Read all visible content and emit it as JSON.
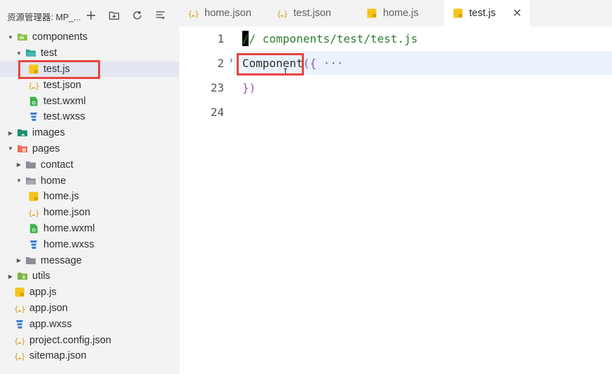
{
  "explorer": {
    "title": "资源管理器: MP_...",
    "actions": [
      "new-file-icon",
      "new-folder-icon",
      "refresh-icon",
      "collapse-all-icon"
    ]
  },
  "tree": [
    {
      "label": "components",
      "type": "folder",
      "icon": "folder-components",
      "depth": 0,
      "expanded": true
    },
    {
      "label": "test",
      "type": "folder",
      "icon": "folder-open",
      "depth": 1,
      "expanded": true
    },
    {
      "label": "test.js",
      "type": "js",
      "depth": 2,
      "selected": true
    },
    {
      "label": "test.json",
      "type": "json",
      "depth": 2
    },
    {
      "label": "test.wxml",
      "type": "wxml",
      "depth": 2
    },
    {
      "label": "test.wxss",
      "type": "wxss",
      "depth": 2
    },
    {
      "label": "images",
      "type": "folder",
      "icon": "folder-images",
      "depth": 0,
      "expanded": false
    },
    {
      "label": "pages",
      "type": "folder",
      "icon": "folder-pages",
      "depth": 0,
      "expanded": true
    },
    {
      "label": "contact",
      "type": "folder",
      "icon": "folder-gray",
      "depth": 1,
      "expanded": false
    },
    {
      "label": "home",
      "type": "folder",
      "icon": "folder-gray-open",
      "depth": 1,
      "expanded": true
    },
    {
      "label": "home.js",
      "type": "js",
      "depth": 2
    },
    {
      "label": "home.json",
      "type": "json",
      "depth": 2
    },
    {
      "label": "home.wxml",
      "type": "wxml",
      "depth": 2
    },
    {
      "label": "home.wxss",
      "type": "wxss",
      "depth": 2
    },
    {
      "label": "message",
      "type": "folder",
      "icon": "folder-gray",
      "depth": 1,
      "expanded": false
    },
    {
      "label": "utils",
      "type": "folder",
      "icon": "folder-utils",
      "depth": 0,
      "expanded": false
    },
    {
      "label": "app.js",
      "type": "js",
      "depth": 0
    },
    {
      "label": "app.json",
      "type": "json",
      "depth": 0
    },
    {
      "label": "app.wxss",
      "type": "wxss",
      "depth": 0
    },
    {
      "label": "project.config.json",
      "type": "json",
      "depth": 0
    },
    {
      "label": "sitemap.json",
      "type": "json",
      "depth": 0
    }
  ],
  "tabs": [
    {
      "label": "home.json",
      "type": "json"
    },
    {
      "label": "test.json",
      "type": "json"
    },
    {
      "label": "home.js",
      "type": "js"
    },
    {
      "label": "test.js",
      "type": "js",
      "active": true,
      "close": "✕"
    }
  ],
  "editor": {
    "lines": [
      {
        "number": "1",
        "comment": "// components/test/test.js"
      },
      {
        "number": "2",
        "ident": "Component",
        "paren": "(",
        "brace": "{",
        "ellipsis": "···"
      },
      {
        "number": "23",
        "brace": "}",
        "paren": ")"
      },
      {
        "number": "24"
      }
    ]
  },
  "colors": {
    "sidebar_bg": "#f3f3f3",
    "selection_bg": "#e4e6f1",
    "highlight_box": "#e8443f",
    "comment": "#2e7d32",
    "bracket": "#a44fbf",
    "current_line": "#eaf3fd"
  }
}
